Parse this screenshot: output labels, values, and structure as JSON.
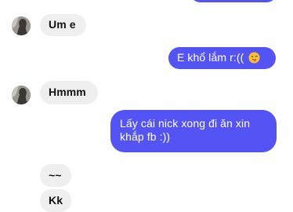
{
  "conversation": {
    "messages": [
      {
        "direction": "incoming",
        "text": "Um e"
      },
      {
        "direction": "outgoing",
        "text": "E khổ lắm r:((",
        "emoji": "winking-face-tongue-emoji"
      },
      {
        "direction": "incoming",
        "text": "Hmmm"
      },
      {
        "direction": "outgoing",
        "text_line1": "Lấy cái nick xong đi ăn xin",
        "text_line2": "khắp fb :))"
      },
      {
        "direction": "incoming",
        "text": "~~"
      },
      {
        "direction": "incoming",
        "text": "Kk"
      }
    ]
  },
  "colors": {
    "outgoing_bubble": "#5454f5",
    "incoming_bubble": "#efefef",
    "background": "#ffffff"
  }
}
